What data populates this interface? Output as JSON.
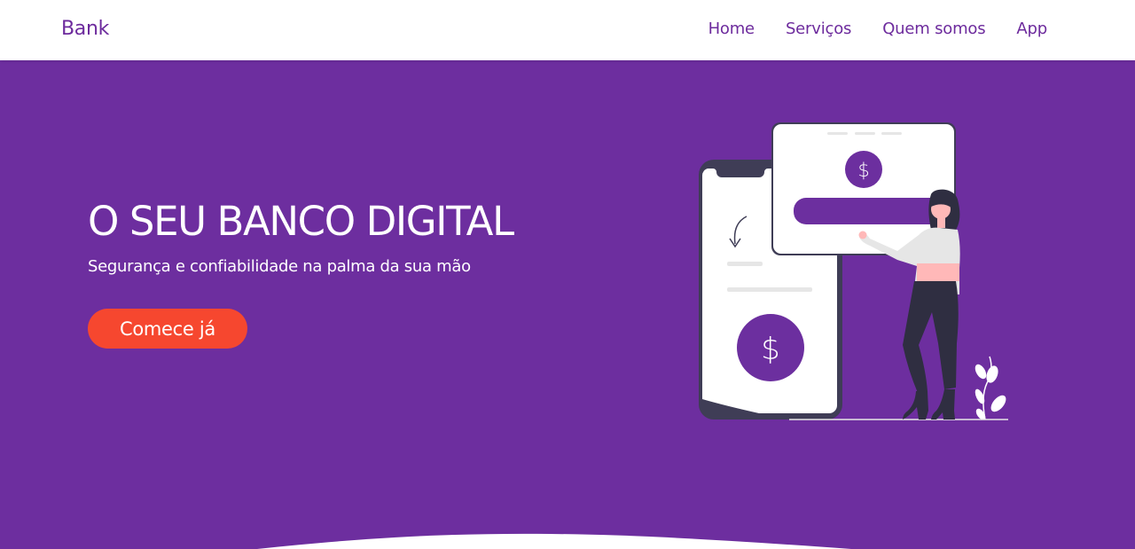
{
  "navbar": {
    "brand": "Bank",
    "links": [
      {
        "label": "Home"
      },
      {
        "label": "Serviços"
      },
      {
        "label": "Quem somos"
      },
      {
        "label": "App"
      }
    ]
  },
  "hero": {
    "title": "O SEU BANCO DIGITAL",
    "subtitle": "Segurança e confiabilidade na palma da sua mão",
    "cta_label": "Comece já"
  },
  "illustration": {
    "icons": [
      "dollar-icon",
      "dollar-icon"
    ]
  },
  "colors": {
    "brand_purple": "#6d2b9d",
    "hero_background": "#6d2e9f",
    "cta_orange": "#f6472f",
    "white": "#ffffff"
  }
}
